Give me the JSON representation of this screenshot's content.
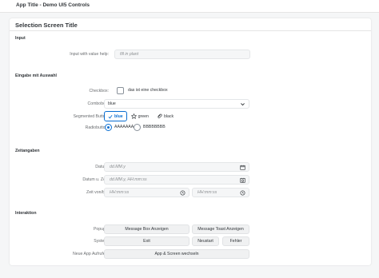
{
  "app": {
    "title": "App Title - Demo UI5 Controls"
  },
  "page": {
    "title": "Selection Screen Title"
  },
  "sections": {
    "input": "Input",
    "selection": "Eingabe mit Auswahl",
    "time": "Zeitangaben",
    "interaction": "Interaktion"
  },
  "input_section": {
    "value_help_label": "Input with value help:",
    "value_help_placeholder": "fill in plant"
  },
  "selection_section": {
    "checkbox_label": "Checkbox:",
    "checkbox_text": "das ist eine checkbox",
    "checkbox_checked": false,
    "combobox_label": "Combobox:",
    "combobox_value": "blue",
    "segmented_label": "Segmented Button:",
    "segmented_items": [
      "blue",
      "green",
      "black"
    ],
    "segmented_selected": "blue",
    "radio_label": "Radiobutton:",
    "radio_options": [
      "AAAAAAA",
      "BBBBBBBB"
    ],
    "radio_selected": "AAAAAAA"
  },
  "time_section": {
    "date_label": "Datum:",
    "date_placeholder": "dd.MM.y",
    "datetime_label": "Datum u. Zeit:",
    "datetime_placeholder": "dd.MM.y, HH:mm:ss",
    "time_label": "Zeit von/bis:",
    "time_from_placeholder": "HH:mm:ss",
    "time_to_placeholder": "HH:mm:ss"
  },
  "interaction_section": {
    "popups_label": "Popups:",
    "message_box_button": "Message Box Anzeigen",
    "message_toast_button": "Message Toast Anzeigen",
    "system_label": "System:",
    "exit_button": "Exit",
    "restart_button": "Neustart",
    "error_button": "Fehler",
    "new_app_label": "Neue App Aufrufen:",
    "switch_app_button": "App & Screen wechseln"
  },
  "colors": {
    "accent": "#0a6ed1",
    "text": "#32363a",
    "label": "#6a6d70",
    "background": "#f5f6f7"
  },
  "icons": {
    "combobox": "chevron-down-icon",
    "segment_blue": "checkmark-icon",
    "segment_green": "star-icon",
    "segment_black": "paperclip-icon",
    "date": "calendar-icon",
    "datetime": "calendar-clock-icon",
    "time": "clock-icon"
  }
}
